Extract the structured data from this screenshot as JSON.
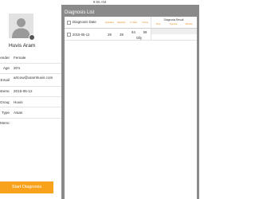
{
  "status_bar": {
    "time": "9:55 AM"
  },
  "profile": {
    "name": "Huvis Aram",
    "fields": [
      {
        "key": "ender",
        "value": "Female"
      },
      {
        "key": "Age",
        "value": "20's"
      },
      {
        "key": "Email",
        "value": "artcow@aramhuvis.com"
      },
      {
        "key": "stered",
        "value": "2015-05-12"
      },
      {
        "key": "Group",
        "value": "Huvis"
      },
      {
        "key": "Type",
        "value": "Asian"
      },
      {
        "key": "Memo",
        "value": ""
      }
    ],
    "start_button": "Start Diagnosis"
  },
  "diagnosis": {
    "title": "Diagnosis List",
    "header": {
      "date": "Diagnosis Date",
      "columns": [
        "Hydration",
        "Elasticity",
        "O. Sebu",
        "T.Zone"
      ],
      "result_title": "Diagnosis Result",
      "result_columns": [
        "Pore",
        "Pigment",
        "Wrinkle"
      ]
    },
    "rows": [
      {
        "date": "2015-05-12",
        "values": [
          "39",
          "39",
          "64",
          "59"
        ],
        "note": "Oily"
      }
    ]
  },
  "colors": {
    "accent": "#f7a21a",
    "panel_bg": "#8a8a8a"
  }
}
